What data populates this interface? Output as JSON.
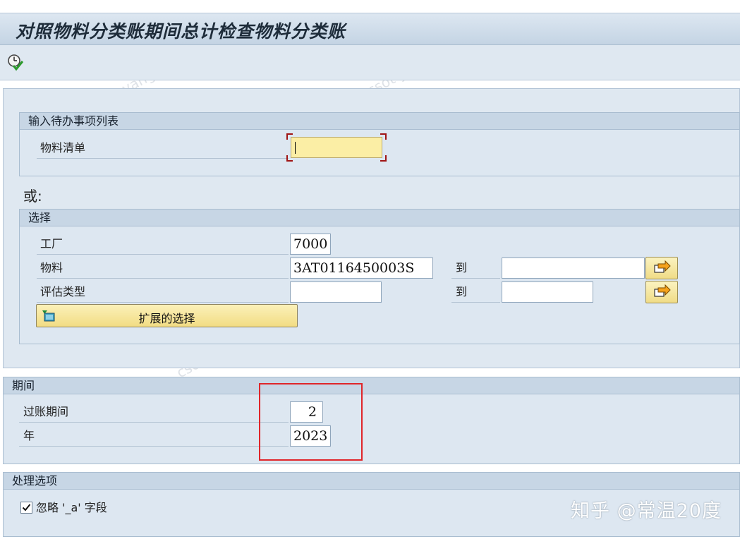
{
  "window": {
    "title": "对照物料分类账期间总计检查物料分类账"
  },
  "toolbar": {
    "execute_icon": "execute-clock-check-icon"
  },
  "worklist_group": {
    "title": "输入待办事项列表",
    "material_list_label": "物料清单",
    "material_list_value": ""
  },
  "or_label": "或:",
  "selection_group": {
    "title": "选择",
    "plant_label": "工厂",
    "plant_value": "7000",
    "material_label": "物料",
    "material_from": "3AT0116450003S",
    "material_to_label": "到",
    "material_to": "",
    "valuation_type_label": "评估类型",
    "valuation_type_from": "",
    "valuation_type_to_label": "到",
    "valuation_type_to": "",
    "multiple_selection_icon": "arrow-multiple-selection-icon",
    "extended_selection_label": "扩展的选择",
    "extended_selection_icon": "tree-node-icon"
  },
  "period_group": {
    "title": "期间",
    "posting_period_label": "过账期间",
    "posting_period_value": "2",
    "year_label": "年",
    "year_value": "2023"
  },
  "options_group": {
    "title": "处理选项",
    "ignore_field_label": "忽略 '_a' 字段",
    "ignore_field_checked": true
  },
  "watermark": {
    "text": "知乎 @常温20度",
    "faint_text": "csot yangyongqing3"
  },
  "colors": {
    "required_field": "#fbeea5",
    "panel_bg": "#dde7f1",
    "highlight_box": "#e0262a"
  }
}
